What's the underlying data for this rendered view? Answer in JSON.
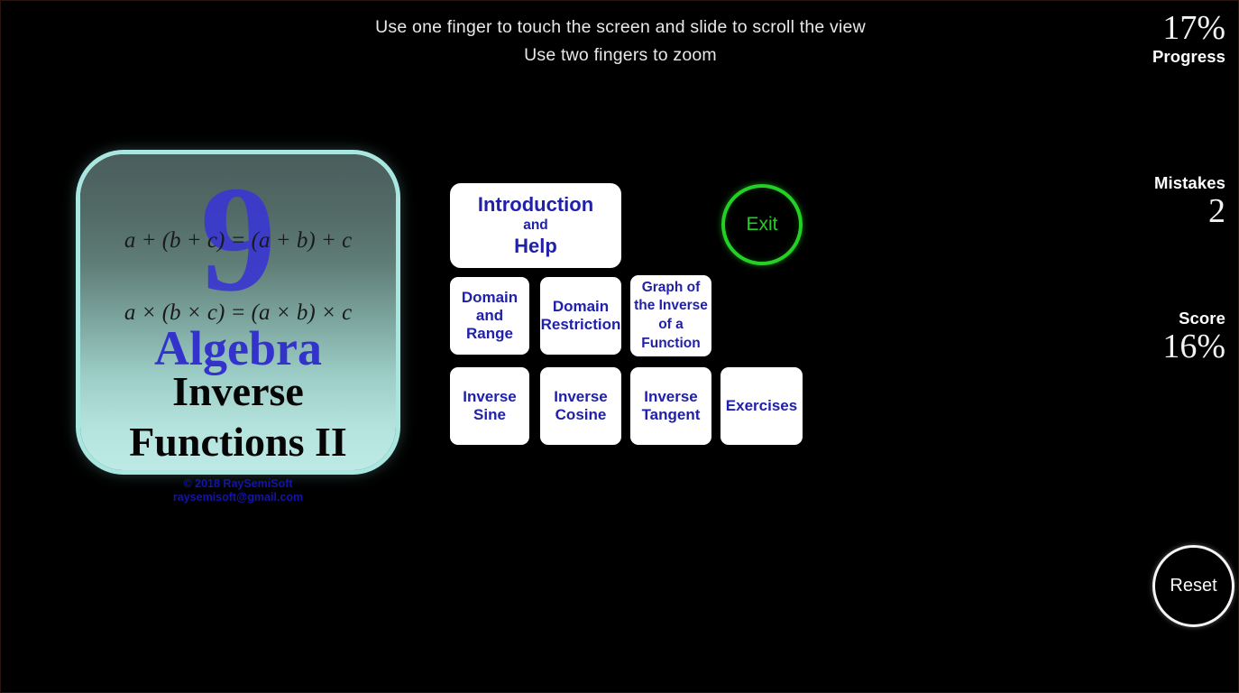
{
  "instructions": {
    "line1": "Use one finger to touch the screen and slide to scroll the view",
    "line2": "Use two fingers to zoom"
  },
  "stats": {
    "progress": {
      "value": "17%",
      "label": "Progress"
    },
    "mistakes": {
      "label": "Mistakes",
      "value": "2"
    },
    "score": {
      "label": "Score",
      "value": "16%"
    }
  },
  "title_card": {
    "big_number": "9",
    "formula_1": "a + (b + c) = (a + b) + c",
    "formula_2": "a × (b × c) = (a × b) × c",
    "subject": "Algebra",
    "topic_line1": "Inverse",
    "topic_line2": "Functions II"
  },
  "copyright": {
    "line1": "© 2018 RaySemiSoft",
    "line2": "raysemisoft@gmail.com"
  },
  "menu": {
    "intro": {
      "line1": "Introduction",
      "line2": "and",
      "line3": "Help"
    },
    "domain_range": {
      "line1": "Domain",
      "line2": "and",
      "line3": "Range"
    },
    "domain_restrict": {
      "line1": "Domain",
      "line2": "Restriction"
    },
    "graph_inverse": {
      "line1": "Graph of",
      "line2": "the Inverse",
      "line3": "of a",
      "line4": "Function"
    },
    "inverse_sine": {
      "line1": "Inverse",
      "line2": "Sine"
    },
    "inverse_cosine": {
      "line1": "Inverse",
      "line2": "Cosine"
    },
    "inverse_tangent": {
      "line1": "Inverse",
      "line2": "Tangent"
    },
    "exercises": {
      "line1": "Exercises"
    }
  },
  "actions": {
    "exit": "Exit",
    "reset": "Reset"
  },
  "colors": {
    "background": "#000000",
    "menu_button_text": "#2020aa",
    "menu_button_bg": "#ffffff",
    "exit_green": "#23d023",
    "reset_white": "#f8f8f8",
    "card_border": "#a9e6e0",
    "card_subject_blue": "#3333cc",
    "copyright_blue": "#1414a8",
    "instruction_text": "#e8e8e8"
  }
}
